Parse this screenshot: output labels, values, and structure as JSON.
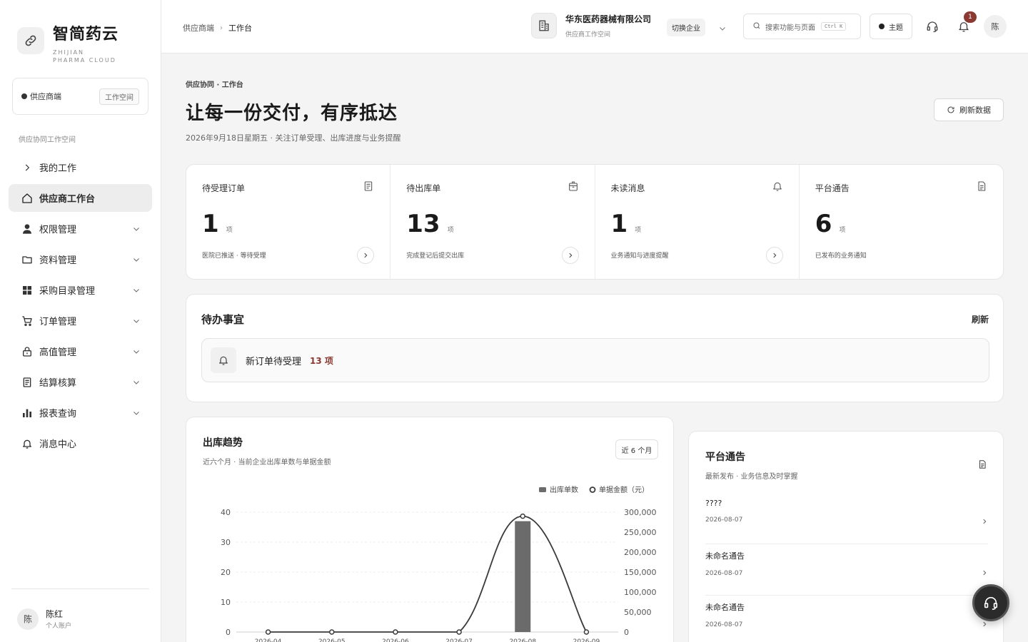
{
  "brand": {
    "name": "智简药云",
    "sub": "ZHIJIAN PHARMA CLOUD"
  },
  "role": {
    "label": "供应商端",
    "workspace_btn": "工作空间"
  },
  "nav": {
    "section": "供应协同工作空间",
    "items": [
      {
        "label": "我的工作",
        "icon": "chevron-right-icon",
        "has_children": false
      },
      {
        "label": "供应商工作台",
        "icon": "home-icon",
        "has_children": false,
        "active": true
      },
      {
        "label": "权限管理",
        "icon": "user-icon",
        "has_children": true
      },
      {
        "label": "资料管理",
        "icon": "folder-icon",
        "has_children": true
      },
      {
        "label": "采购目录管理",
        "icon": "grid-icon",
        "has_children": true
      },
      {
        "label": "订单管理",
        "icon": "cart-icon",
        "has_children": true
      },
      {
        "label": "高值管理",
        "icon": "lock-icon",
        "has_children": true
      },
      {
        "label": "结算核算",
        "icon": "document-icon",
        "has_children": true
      },
      {
        "label": "报表查询",
        "icon": "bar-chart-icon",
        "has_children": true
      },
      {
        "label": "消息中心",
        "icon": "bell-icon",
        "has_children": false
      }
    ]
  },
  "user": {
    "avatar": "陈",
    "name": "陈红",
    "role": "个人账户"
  },
  "header": {
    "crumb_root": "供应商端",
    "crumb_current": "工作台",
    "company_name": "华东医药器械有限公司",
    "company_sub": "供应商工作空间",
    "switch_label": "切换企业",
    "search_placeholder": "搜索功能与页面",
    "search_shortcut": "Ctrl K",
    "theme_label": "主题",
    "notif_count": "1",
    "avatar": "陈"
  },
  "page": {
    "eyebrow": "供应协同 · 工作台",
    "title": "让每一份交付，有序抵达",
    "subtitle": "2026年9月18日星期五 · 关注订单受理、出库进度与业务提醒",
    "refresh_label": "刷新数据"
  },
  "stats": [
    {
      "label": "待受理订单",
      "value": "1",
      "unit": "项",
      "desc": "医院已推送 · 等待受理",
      "has_link": true,
      "icon": "document-icon"
    },
    {
      "label": "待出库单",
      "value": "13",
      "unit": "项",
      "desc": "完成登记后提交出库",
      "has_link": true,
      "icon": "package-icon"
    },
    {
      "label": "未读消息",
      "value": "1",
      "unit": "项",
      "desc": "业务通知与进度提醒",
      "has_link": true,
      "icon": "bell-icon"
    },
    {
      "label": "平台通告",
      "value": "6",
      "unit": "项",
      "desc": "已发布的业务通知",
      "has_link": false,
      "icon": "file-icon"
    }
  ],
  "todo": {
    "title": "待办事宜",
    "refresh": "刷新",
    "item_text": "新订单待受理",
    "item_count": "13 项"
  },
  "trend": {
    "title": "出库趋势",
    "subtitle": "近六个月 · 当前企业出库单数与单据金额",
    "range": "近 6 个月"
  },
  "chart_data": {
    "type": "bar",
    "categories": [
      "2026-04",
      "2026-05",
      "2026-06",
      "2026-07",
      "2026-08",
      "2026-09"
    ],
    "series": [
      {
        "name": "出库单数",
        "type": "bar",
        "axis": "left",
        "values": [
          0,
          0,
          0,
          0,
          37,
          0
        ]
      },
      {
        "name": "单据金额（元）",
        "type": "line",
        "axis": "right",
        "smooth": true,
        "values": [
          0,
          0,
          0,
          0,
          290000,
          0
        ]
      }
    ],
    "y_left": {
      "ticks": [
        "0",
        "10",
        "20",
        "30",
        "40"
      ],
      "range": [
        0,
        40
      ]
    },
    "y_right": {
      "ticks": [
        "0",
        "50,000",
        "100,000",
        "150,000",
        "200,000",
        "250,000",
        "300,000"
      ],
      "range": [
        0,
        300000
      ]
    },
    "legend": "top-right",
    "grid": true,
    "colors": {
      "bar": "#6b6b6b",
      "line": "#3a3a3a"
    }
  },
  "notice": {
    "title": "平台通告",
    "subtitle": "最新发布 · 业务信息及时掌握",
    "items": [
      {
        "name": "????",
        "date": "2026-08-07"
      },
      {
        "name": "未命名通告",
        "date": "2026-08-07"
      },
      {
        "name": "未命名通告",
        "date": "2026-08-07"
      }
    ]
  },
  "colors": {
    "accent": "#8a3a32",
    "text": "#1f1f1f",
    "bg": "#f4f4f4"
  }
}
